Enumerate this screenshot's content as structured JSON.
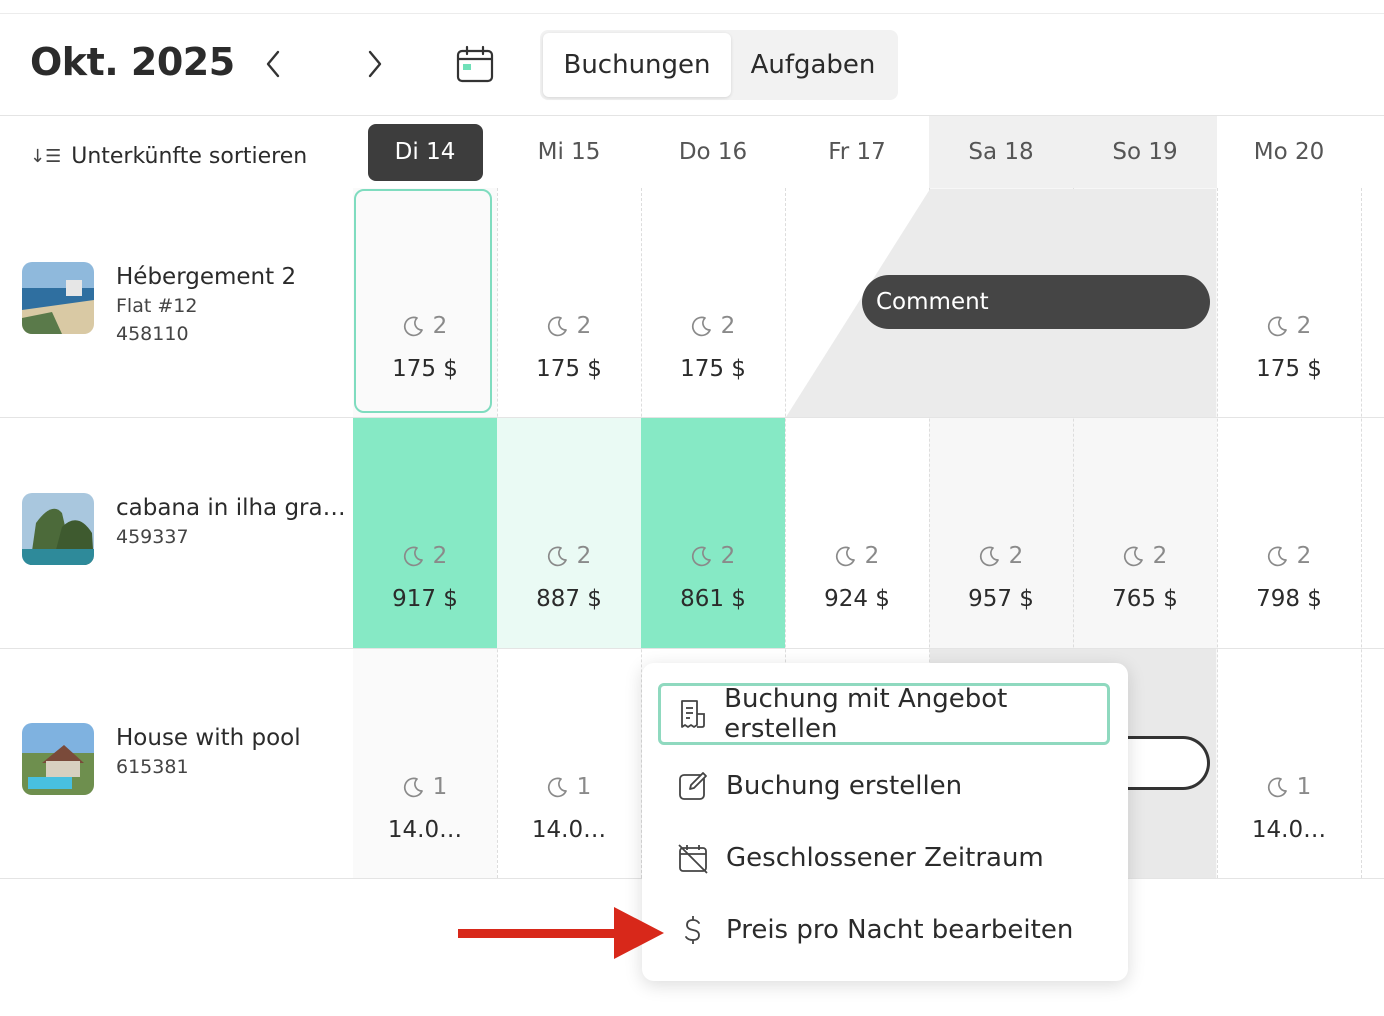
{
  "header": {
    "month_title": "Okt. 2025",
    "tabs": [
      {
        "label": "Buchungen",
        "active": true
      },
      {
        "label": "Aufgaben",
        "active": false
      }
    ]
  },
  "sidebar": {
    "sort_label": "Unterkünfte sortieren",
    "properties": [
      {
        "name": "Hébergement 2",
        "subtitle": "Flat #12",
        "id": "458110"
      },
      {
        "name": "cabana in ilha gra…",
        "id": "459337"
      },
      {
        "name": "House with pool",
        "id": "615381"
      }
    ]
  },
  "days": [
    {
      "label": "Di 14",
      "today": true,
      "weekend": false
    },
    {
      "label": "Mi 15",
      "today": false,
      "weekend": false
    },
    {
      "label": "Do 16",
      "today": false,
      "weekend": false
    },
    {
      "label": "Fr 17",
      "today": false,
      "weekend": false
    },
    {
      "label": "Sa 18",
      "today": false,
      "weekend": true
    },
    {
      "label": "So 19",
      "today": false,
      "weekend": true
    },
    {
      "label": "Mo 20",
      "today": false,
      "weekend": false
    }
  ],
  "rows": [
    {
      "cells": [
        {
          "nights": "2",
          "price": "175 $"
        },
        {
          "nights": "2",
          "price": "175 $"
        },
        {
          "nights": "2",
          "price": "175 $"
        },
        null,
        null,
        null,
        {
          "nights": "2",
          "price": "175 $"
        }
      ]
    },
    {
      "cells": [
        {
          "nights": "2",
          "price": "917 $",
          "highlight": "strong"
        },
        {
          "nights": "2",
          "price": "887 $",
          "highlight": "light"
        },
        {
          "nights": "2",
          "price": "861 $",
          "highlight": "strong"
        },
        {
          "nights": "2",
          "price": "924 $"
        },
        {
          "nights": "2",
          "price": "957 $"
        },
        {
          "nights": "2",
          "price": "765 $"
        },
        {
          "nights": "2",
          "price": "798 $"
        }
      ]
    },
    {
      "cells": [
        {
          "nights": "1",
          "price": "14.0…"
        },
        {
          "nights": "1",
          "price": "14.0…"
        },
        null,
        null,
        null,
        null,
        {
          "nights": "1",
          "price": "14.0…"
        }
      ]
    }
  ],
  "booking_comment": "Comment",
  "context_menu": {
    "items": [
      {
        "label": "Buchung mit Angebot erstellen",
        "icon": "quote-document-icon",
        "focused": true
      },
      {
        "label": "Buchung erstellen",
        "icon": "edit-icon",
        "focused": false
      },
      {
        "label": "Geschlossener Zeitraum",
        "icon": "calendar-blocked-icon",
        "focused": false
      },
      {
        "label": "Preis pro Nacht bearbeiten",
        "icon": "dollar-icon",
        "focused": false
      }
    ]
  },
  "colors": {
    "highlight_strong": "#86e9c5",
    "highlight_light": "#eafaf4",
    "weekend_bg": "#f0f0f0",
    "blocked_bg": "#e6e6e6",
    "today_pill": "#3d3d3d",
    "arrow": "#d8281a"
  }
}
